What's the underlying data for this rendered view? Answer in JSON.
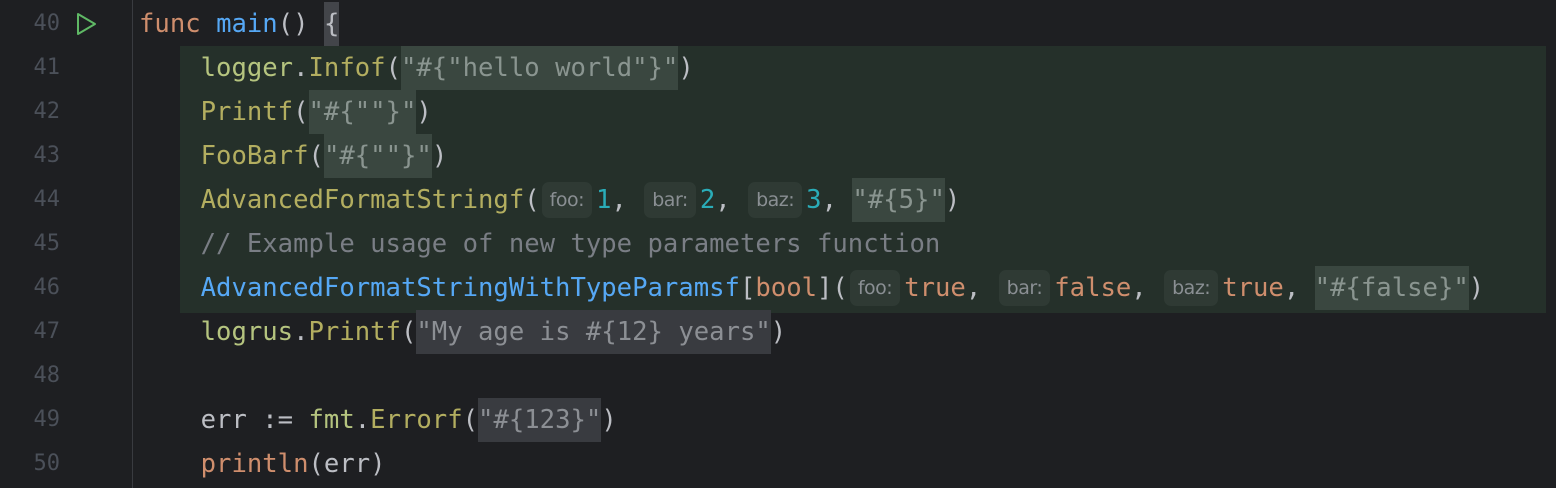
{
  "editor": {
    "lines": [
      {
        "num": "40",
        "run": true,
        "tokens": [
          {
            "t": "func",
            "c": "kw"
          },
          {
            "t": " "
          },
          {
            "t": "main",
            "c": "fn"
          },
          {
            "t": "() "
          },
          {
            "t": "{",
            "c": "brace"
          }
        ]
      },
      {
        "num": "41",
        "tokens": [
          {
            "t": "    "
          },
          {
            "t": "logger",
            "c": "pkg"
          },
          {
            "t": "."
          },
          {
            "t": "Infof",
            "c": "call"
          },
          {
            "t": "("
          },
          {
            "t": "\"#{\"hello world\"}\"",
            "c": "str"
          },
          {
            "t": ")"
          }
        ]
      },
      {
        "num": "42",
        "tokens": [
          {
            "t": "    "
          },
          {
            "t": "Printf",
            "c": "call"
          },
          {
            "t": "("
          },
          {
            "t": "\"#{\"\"}\"",
            "c": "str"
          },
          {
            "t": ")"
          }
        ]
      },
      {
        "num": "43",
        "tokens": [
          {
            "t": "    "
          },
          {
            "t": "FooBarf",
            "c": "call"
          },
          {
            "t": "("
          },
          {
            "t": "\"#{\"\"}\"",
            "c": "str"
          },
          {
            "t": ")"
          }
        ]
      },
      {
        "num": "44",
        "tokens": [
          {
            "t": "    "
          },
          {
            "t": "AdvancedFormatStringf",
            "c": "call"
          },
          {
            "t": "("
          },
          {
            "t": "foo:",
            "c": "hint"
          },
          {
            "t": "1",
            "c": "num"
          },
          {
            "t": ", "
          },
          {
            "t": "bar:",
            "c": "hint"
          },
          {
            "t": "2",
            "c": "num"
          },
          {
            "t": ", "
          },
          {
            "t": "baz:",
            "c": "hint"
          },
          {
            "t": "3",
            "c": "num"
          },
          {
            "t": ", "
          },
          {
            "t": "\"#{5}\"",
            "c": "str"
          },
          {
            "t": ")"
          }
        ]
      },
      {
        "num": "45",
        "tokens": [
          {
            "t": "    "
          },
          {
            "t": "// Example usage of new type parameters function",
            "c": "cmt"
          }
        ]
      },
      {
        "num": "46",
        "tokens": [
          {
            "t": "    "
          },
          {
            "t": "AdvancedFormatStringWithTypeParamsf",
            "c": "fn"
          },
          {
            "t": "["
          },
          {
            "t": "bool",
            "c": "kw"
          },
          {
            "t": "]("
          },
          {
            "t": "foo:",
            "c": "hint"
          },
          {
            "t": "true",
            "c": "kw"
          },
          {
            "t": ", "
          },
          {
            "t": "bar:",
            "c": "hint"
          },
          {
            "t": "false",
            "c": "kw"
          },
          {
            "t": ", "
          },
          {
            "t": "baz:",
            "c": "hint"
          },
          {
            "t": "true",
            "c": "kw"
          },
          {
            "t": ", "
          },
          {
            "t": "\"#{false}\"",
            "c": "str"
          },
          {
            "t": ")"
          }
        ]
      },
      {
        "num": "47",
        "tokens": [
          {
            "t": "    "
          },
          {
            "t": "logrus",
            "c": "pkg"
          },
          {
            "t": "."
          },
          {
            "t": "Printf",
            "c": "call"
          },
          {
            "t": "("
          },
          {
            "t": "\"My age is #{12} years\"",
            "c": "str2"
          },
          {
            "t": ")"
          }
        ]
      },
      {
        "num": "48",
        "tokens": []
      },
      {
        "num": "49",
        "tokens": [
          {
            "t": "    err := "
          },
          {
            "t": "fmt",
            "c": "pkg"
          },
          {
            "t": "."
          },
          {
            "t": "Errorf",
            "c": "call"
          },
          {
            "t": "("
          },
          {
            "t": "\"#{123}\"",
            "c": "str2"
          },
          {
            "t": ")"
          }
        ]
      },
      {
        "num": "50",
        "tokens": [
          {
            "t": "    "
          },
          {
            "t": "println",
            "c": "kw"
          },
          {
            "t": "(err)"
          }
        ]
      }
    ]
  }
}
